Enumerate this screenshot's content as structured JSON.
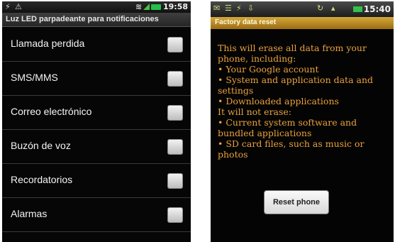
{
  "left_screen": {
    "status_bar": {
      "time": "19:58"
    },
    "title": "Luz LED parpadeante para notificaciones",
    "settings": [
      {
        "label": "Llamada perdida"
      },
      {
        "label": "SMS/MMS"
      },
      {
        "label": "Correo electrónico"
      },
      {
        "label": "Buzón de voz"
      },
      {
        "label": "Recordatorios"
      },
      {
        "label": "Alarmas"
      }
    ]
  },
  "right_screen": {
    "status_bar": {
      "time": "15:40"
    },
    "title": "Factory data reset",
    "intro": "This will erase all data from your phone, including:",
    "erase_items": [
      "• Your Google account",
      "• System and application data and settings",
      "• Downloaded applications"
    ],
    "not_erase_heading": "It will not erase:",
    "keep_items": [
      "• Current system software and bundled applications",
      "• SD card files, such as music or photos"
    ],
    "button_label": "Reset phone"
  },
  "colors": {
    "warning_text": "#e8a23c",
    "title_bar_right": "#c49228",
    "checkbox": "#e6e6e6",
    "battery": "#2fc04a"
  }
}
